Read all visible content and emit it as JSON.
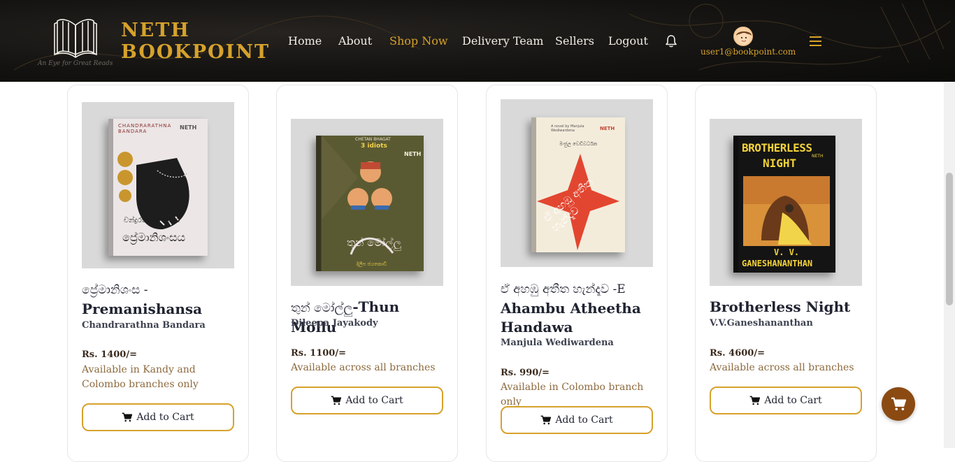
{
  "brand": {
    "line1": "NETH",
    "line2": "BOOKPOINT",
    "tagline": "An Eye for Great Reads"
  },
  "nav": [
    {
      "label": "Home",
      "active": false
    },
    {
      "label": "About",
      "active": false
    },
    {
      "label": "Shop Now",
      "active": true
    },
    {
      "label": "Delivery Team",
      "active": false
    },
    {
      "label": "Sellers",
      "active": false
    },
    {
      "label": "Logout",
      "active": false
    }
  ],
  "user": {
    "email": "user1@bookpoint.com",
    "avatar_icon": "avatar-face-icon"
  },
  "icons": {
    "bell": "bell-icon",
    "menu": "hamburger-menu-icon",
    "cart": "cart-icon"
  },
  "colors": {
    "accent": "#d6a22c",
    "header_bg": "#141311",
    "fab_bg": "#8b4a12",
    "availability_text": "#8d6a3e"
  },
  "products": [
    {
      "title_si": "ප්‍රේමානිශංස -",
      "title_en": "Premanishansa",
      "author": "Chandrarathna Bandara",
      "price": "Rs. 1400/=",
      "availability": "Available in Kandy and Colombo branches only",
      "button": "Add to Cart",
      "cover": {
        "author_text": "CHANDRARATHNA BANDARA",
        "publisher": "NETH",
        "title_text": "ප්‍රේමානිශංසය",
        "author_si": "චන්ද්‍රරත්න බණ්ඩාර"
      }
    },
    {
      "title_si": "තුන් මෝල්ලු",
      "title_en": "-Thun Mollu",
      "author": "Dileepa Jayakody",
      "price": "Rs. 1100/=",
      "availability": "Available across all branches",
      "button": "Add to Cart",
      "cover": {
        "top_text": "CHETAN BHAGAT",
        "sub_text": "3 idiots",
        "publisher": "NETH",
        "title_text": "තුන් මෝල්ලු",
        "author_si": "දිලීප ජයකොඩි"
      }
    },
    {
      "title_si": "ඒ අහඹු අතීත හැන්දෑව -E",
      "title_en": "Ahambu Atheetha Handawa",
      "author": "Manjula Wediwardena",
      "price": "Rs. 990/=",
      "availability": "Available in Colombo branch only",
      "button": "Add to Cart",
      "cover": {
        "top_text": "A novel by Manjula Wediwardena",
        "publisher": "NETH",
        "title_text": "ඒ අහඹු අතීත හැන්දෑව",
        "author_si": "මංජුල වෙඩිවර්ධන"
      }
    },
    {
      "title_si": "",
      "title_en": "Brotherless Night",
      "author": "V.V.Ganeshananthan",
      "price": "Rs. 4600/=",
      "availability": "Available across all branches",
      "button": "Add to Cart",
      "cover": {
        "title_line1": "BROTHERLESS",
        "title_line2": "NIGHT",
        "author_line1": "V. V.",
        "author_line2": "GANESHANANTHAN",
        "publisher": "NETH"
      }
    }
  ]
}
